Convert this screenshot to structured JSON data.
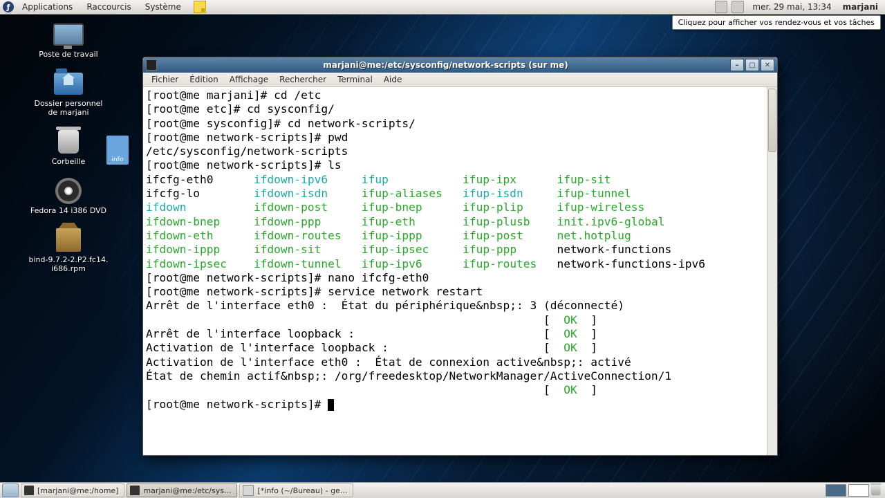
{
  "panel": {
    "menus": [
      "Applications",
      "Raccourcis",
      "Système"
    ],
    "clock": "mer. 29 mai, 13:34",
    "user": "marjani",
    "tooltip": "Cliquez pour afficher vos rendez-vous et vos tâches"
  },
  "desktop_icons": {
    "computer": "Poste de travail",
    "home": "Dossier personnel\nde marjani",
    "trash": "Corbeille",
    "info_file": "info",
    "dvd": "Fedora 14 i386 DVD",
    "pkg": "bind-9.7.2-2.P2.fc14.\ni686.rpm"
  },
  "window": {
    "title": "marjani@me:/etc/sysconfig/network-scripts (sur me)",
    "menus": [
      "Fichier",
      "Édition",
      "Affichage",
      "Rechercher",
      "Terminal",
      "Aide"
    ]
  },
  "terminal": {
    "lines": [
      {
        "t": "[root@me marjani]# cd /etc"
      },
      {
        "t": "[root@me etc]# cd sysconfig/"
      },
      {
        "t": "[root@me sysconfig]# cd network-scripts/"
      },
      {
        "t": "[root@me network-scripts]# pwd"
      },
      {
        "t": "/etc/sysconfig/network-scripts"
      },
      {
        "t": "[root@me network-scripts]# ls"
      }
    ],
    "ls_rows": [
      [
        {
          "t": "ifcfg-eth0",
          "c": ""
        },
        {
          "t": "ifdown-ipv6",
          "c": "c"
        },
        {
          "t": "ifup",
          "c": "c"
        },
        {
          "t": "ifup-ipx",
          "c": "g"
        },
        {
          "t": "ifup-sit",
          "c": "g"
        }
      ],
      [
        {
          "t": "ifcfg-lo",
          "c": ""
        },
        {
          "t": "ifdown-isdn",
          "c": "c"
        },
        {
          "t": "ifup-aliases",
          "c": "g"
        },
        {
          "t": "ifup-isdn",
          "c": "c"
        },
        {
          "t": "ifup-tunnel",
          "c": "g"
        }
      ],
      [
        {
          "t": "ifdown",
          "c": "c"
        },
        {
          "t": "ifdown-post",
          "c": "g"
        },
        {
          "t": "ifup-bnep",
          "c": "g"
        },
        {
          "t": "ifup-plip",
          "c": "g"
        },
        {
          "t": "ifup-wireless",
          "c": "g"
        }
      ],
      [
        {
          "t": "ifdown-bnep",
          "c": "g"
        },
        {
          "t": "ifdown-ppp",
          "c": "g"
        },
        {
          "t": "ifup-eth",
          "c": "g"
        },
        {
          "t": "ifup-plusb",
          "c": "g"
        },
        {
          "t": "init.ipv6-global",
          "c": "g"
        }
      ],
      [
        {
          "t": "ifdown-eth",
          "c": "g"
        },
        {
          "t": "ifdown-routes",
          "c": "g"
        },
        {
          "t": "ifup-ippp",
          "c": "g"
        },
        {
          "t": "ifup-post",
          "c": "g"
        },
        {
          "t": "net.hotplug",
          "c": "g"
        }
      ],
      [
        {
          "t": "ifdown-ippp",
          "c": "g"
        },
        {
          "t": "ifdown-sit",
          "c": "g"
        },
        {
          "t": "ifup-ipsec",
          "c": "g"
        },
        {
          "t": "ifup-ppp",
          "c": "g"
        },
        {
          "t": "network-functions",
          "c": ""
        }
      ],
      [
        {
          "t": "ifdown-ipsec",
          "c": "g"
        },
        {
          "t": "ifdown-tunnel",
          "c": "g"
        },
        {
          "t": "ifup-ipv6",
          "c": "g"
        },
        {
          "t": "ifup-routes",
          "c": "g"
        },
        {
          "t": "network-functions-ipv6",
          "c": ""
        }
      ]
    ],
    "ls_widths": [
      16,
      16,
      15,
      14,
      0
    ],
    "after": [
      "[root@me network-scripts]# nano ifcfg-eth0",
      "[root@me network-scripts]# service network restart",
      "Arrêt de l'interface eth0 :  État du périphérique&nbsp;: 3 (déconnecté)",
      "                                                           [  OK  ]",
      "Arrêt de l'interface loopback :                            [  OK  ]",
      "Activation de l'interface loopback :                       [  OK  ]",
      "Activation de l'interface eth0 :  État de connexion active&nbsp;: activé",
      "État de chemin actif&nbsp;: /org/freedesktop/NetworkManager/ActiveConnection/1",
      "                                                           [  OK  ]"
    ],
    "prompt": "[root@me network-scripts]# "
  },
  "taskbar": {
    "tasks": [
      {
        "label": "[marjani@me:/home]",
        "type": "term"
      },
      {
        "label": "marjani@me:/etc/sys...",
        "type": "term",
        "active": true
      },
      {
        "label": "[*info (~/Bureau) - ge...",
        "type": "gedit"
      }
    ]
  }
}
